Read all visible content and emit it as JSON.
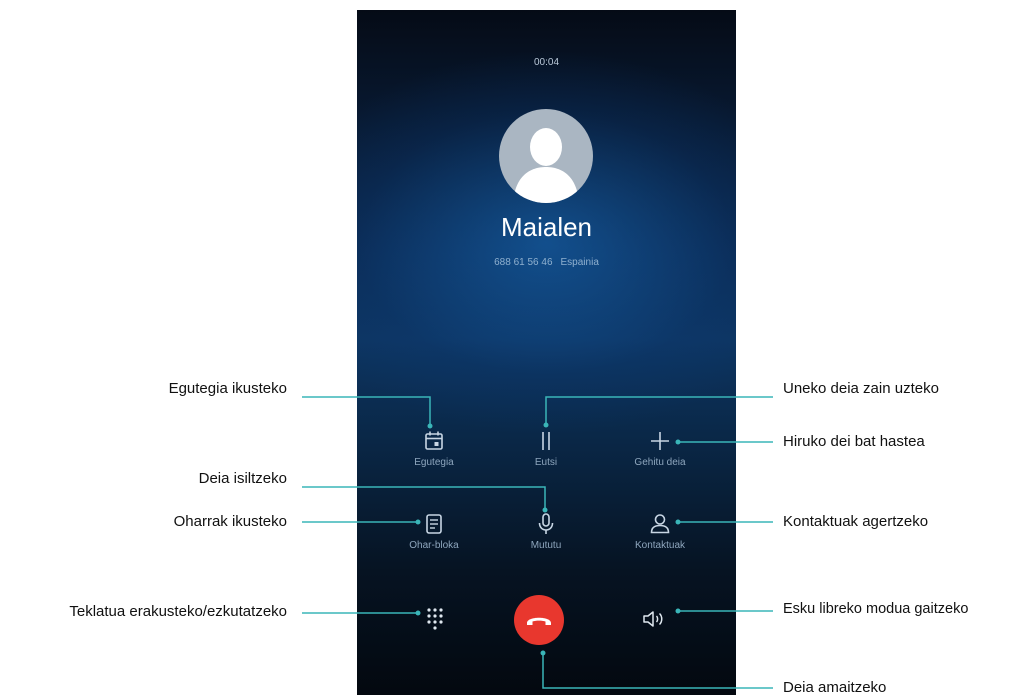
{
  "call": {
    "timer": "00:04",
    "contact_name": "Maialen",
    "phone_number": "688 61 56 46",
    "location": "Espainia"
  },
  "controls": {
    "calendar": {
      "label": "Egutegia",
      "icon": "calendar-icon"
    },
    "hold": {
      "label": "Eutsi",
      "icon": "pause-icon"
    },
    "add_call": {
      "label": "Gehitu deia",
      "icon": "plus-icon"
    },
    "notepad": {
      "label": "Ohar-bloka",
      "icon": "notepad-icon"
    },
    "mute": {
      "label": "Mututu",
      "icon": "microphone-icon"
    },
    "contacts": {
      "label": "Kontaktuak",
      "icon": "person-icon"
    },
    "keypad": {
      "icon": "dialpad-icon"
    },
    "end_call": {
      "icon": "hang-up-icon"
    },
    "speaker": {
      "icon": "speaker-icon"
    }
  },
  "annotations": {
    "calendar": "Egutegia ikusteko",
    "mute": "Deia isiltzeko",
    "notes": "Oharrak ikusteko",
    "keypad": "Teklatua erakusteko/ezkutatzeko",
    "hold": "Uneko deia zain uzteko",
    "add_call": "Hiruko dei bat hastea",
    "contacts": "Kontaktuak agertzeko",
    "speaker": "Esku libreko modua gaitzeko",
    "end_call": "Deia amaitzeko"
  },
  "colors": {
    "leader_line": "#3ab5b8",
    "end_call": "#e8372e",
    "background": "#0b2a52"
  }
}
